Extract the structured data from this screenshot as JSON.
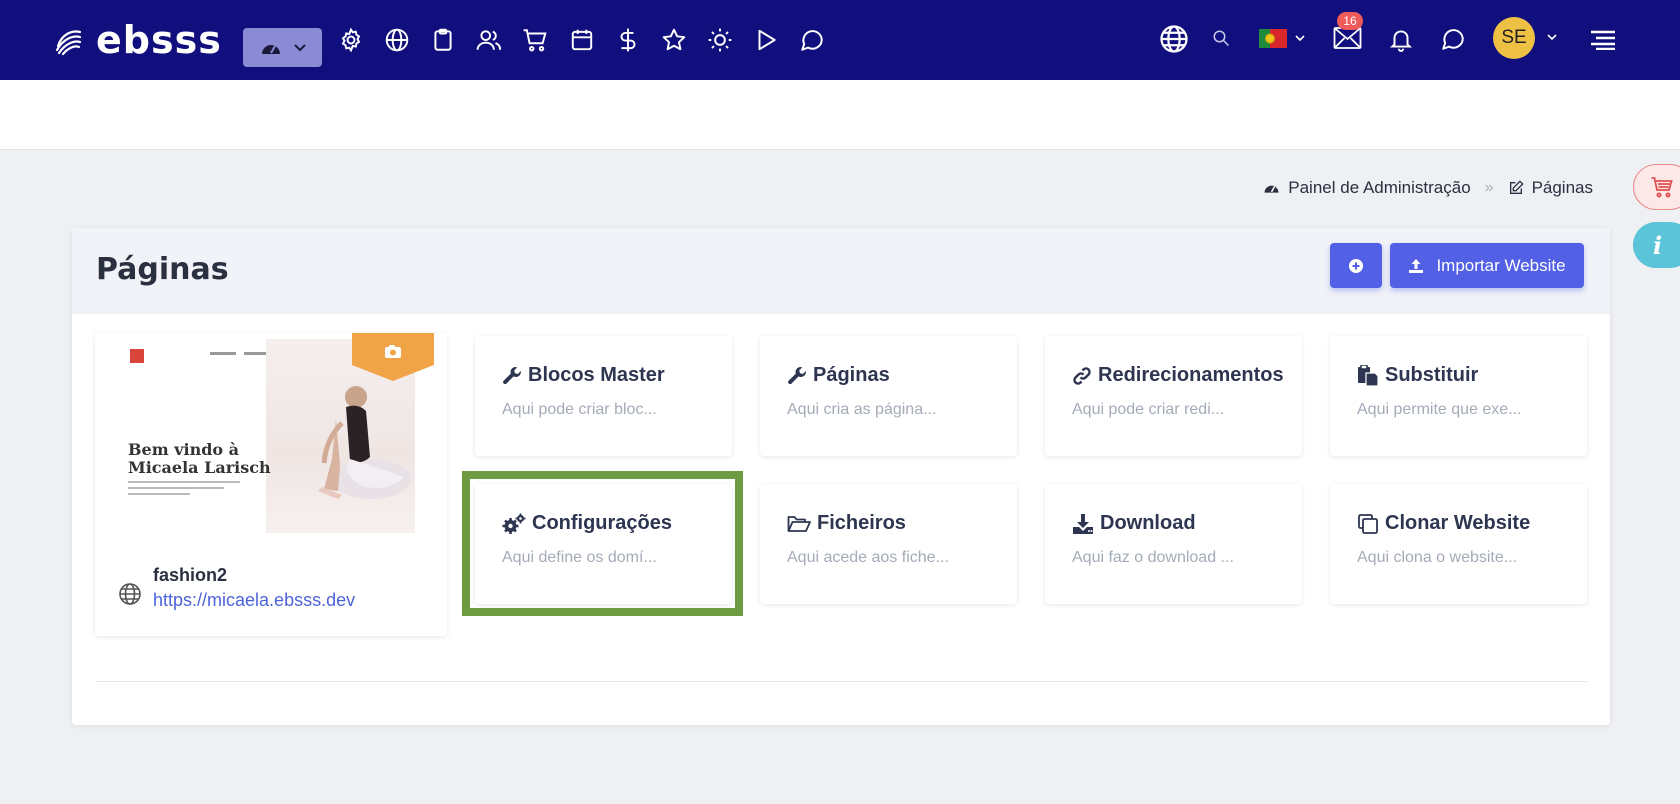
{
  "header": {
    "brand": "ebsss",
    "nav_icons": [
      "dashboard-icon",
      "settings-icon",
      "globe-icon",
      "clipboard-icon",
      "users-icon",
      "cart-icon",
      "calendar-icon",
      "dollar-icon",
      "star-icon",
      "sun-icon",
      "play-icon",
      "chat-icon"
    ],
    "mail_badge": "16",
    "avatar_initials": "SE",
    "language_flag": "flag-portugal-icon"
  },
  "breadcrumb": {
    "home": "Painel de Administração",
    "separator": "»",
    "current": "Páginas"
  },
  "card": {
    "title": "Páginas",
    "import_label": "Importar Website"
  },
  "site": {
    "thumb_heading_line1": "Bem vindo à",
    "thumb_heading_line2": "Micaela Larisch",
    "name": "fashion2",
    "url": "https://micaela.ebsss.dev"
  },
  "tiles": [
    {
      "title": "Blocos Master",
      "desc": "Aqui pode criar bloc...",
      "icon": "wrench-icon"
    },
    {
      "title": "Páginas",
      "desc": "Aqui cria as página...",
      "icon": "wrench-icon"
    },
    {
      "title": "Redirecionamentos",
      "desc": "Aqui pode criar redi...",
      "icon": "link-icon"
    },
    {
      "title": "Substituir",
      "desc": "Aqui permite que exe...",
      "icon": "paste-icon"
    },
    {
      "title": "Configurações",
      "desc": "Aqui define os domí...",
      "icon": "cogs-icon"
    },
    {
      "title": "Ficheiros",
      "desc": "Aqui acede aos fiche...",
      "icon": "folder-open-icon"
    },
    {
      "title": "Download",
      "desc": "Aqui faz o download ...",
      "icon": "download-icon"
    },
    {
      "title": "Clonar Website",
      "desc": "Aqui clona o website...",
      "icon": "copy-icon"
    }
  ],
  "colors": {
    "topbar": "#110f7d",
    "primary": "#5160e4",
    "highlight": "#6e9b42",
    "badge": "#ef5a5a",
    "avatar": "#eec044"
  }
}
